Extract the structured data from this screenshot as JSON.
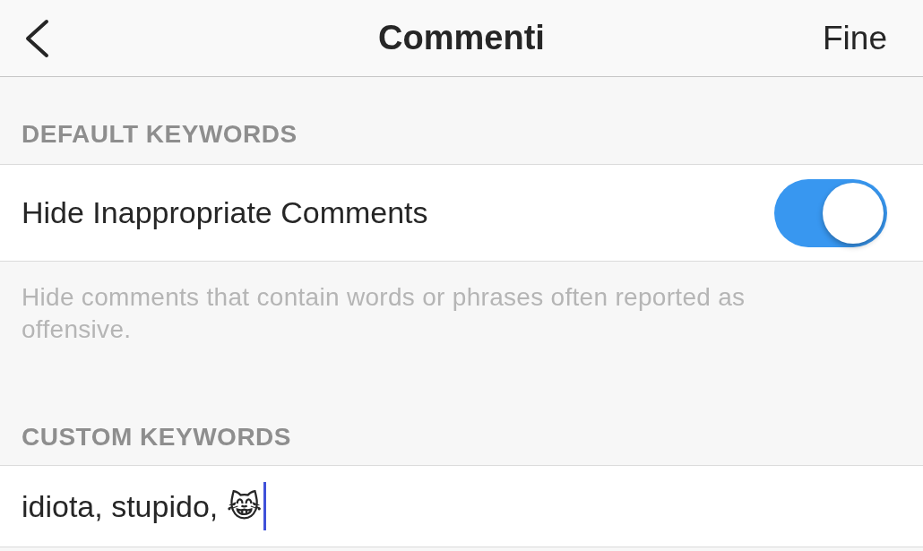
{
  "nav": {
    "title": "Commenti",
    "done": "Fine"
  },
  "sections": [
    {
      "header": "DEFAULT KEYWORDS",
      "kind": "toggle",
      "label": "Hide Inappropriate Comments",
      "on": true,
      "footer": "Hide comments that contain words or phrases often reported as offensive."
    },
    {
      "header": "CUSTOM KEYWORDS",
      "kind": "field",
      "value": "idiota, stupido, 😹"
    }
  ]
}
